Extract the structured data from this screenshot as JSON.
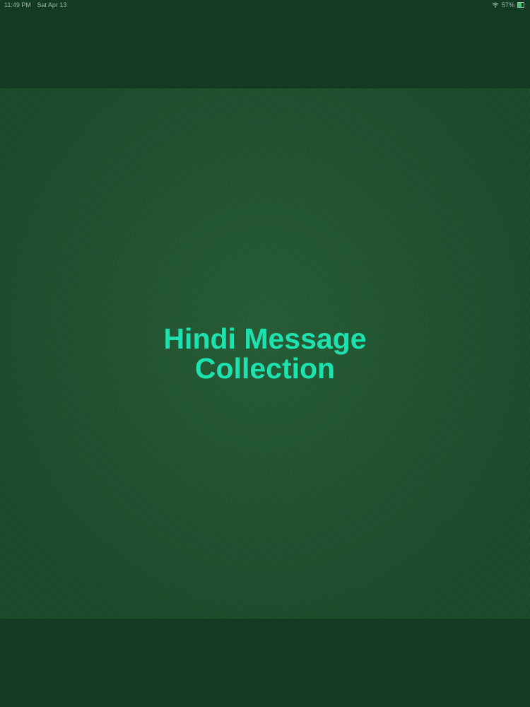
{
  "status_bar": {
    "time": "11:49 PM",
    "date": "Sat Apr 13",
    "battery": "57%",
    "battery_level": 0.57
  },
  "splash": {
    "title_line1": "Hindi Message",
    "title_line2": "Collection"
  },
  "colors": {
    "background": "#143a24",
    "panel": "#1f5530",
    "title": "#1de2b0",
    "battery_fill": "#2dd36f"
  }
}
